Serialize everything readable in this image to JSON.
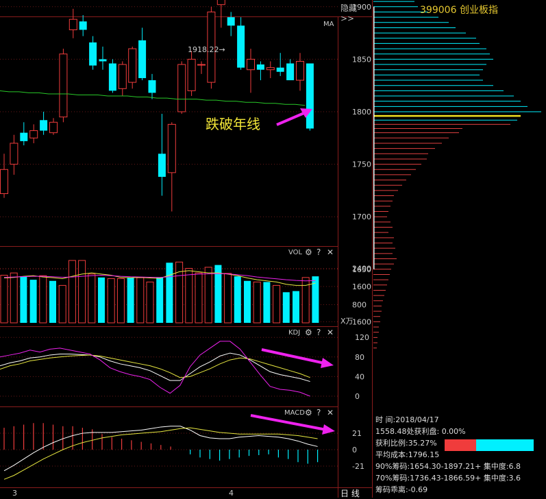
{
  "header": {
    "hide_label": "隐藏>>",
    "stock_title": "399006 创业板指"
  },
  "annotation": {
    "text": "跌破年线",
    "price_marker": "1918.22→"
  },
  "panes": {
    "main_label": "MA",
    "vol_label": "VOL",
    "kdj_label": "KDJ",
    "macd_label": "MACD",
    "vol_unit": "X万",
    "help": "?",
    "close": "✕",
    "settings": "⚙"
  },
  "x_axis": {
    "labels": [
      "3",
      "4"
    ]
  },
  "period_tabs": "日 线",
  "info": {
    "time": "时     间:2018/04/17",
    "profit_line": "1558.48处获利盘: 0.00%",
    "profit_ratio": "获利比例:35.27%",
    "avg_cost": "平均成本:1796.15",
    "chip90": "90%筹码:1654.30-1897.21+ 集中度:6.8",
    "chip70": "70%筹码:1736.43-1866.59+ 集中度:3.6",
    "chip_mult": "筹码乖离:-0.69"
  },
  "colors": {
    "up": "#f03c3c",
    "down": "#00f0ff",
    "ma": "#28c828",
    "title": "#e6c830",
    "arrow": "#ee22ee",
    "k": "#ffffff",
    "d": "#e8e840",
    "j": "#ee22ee"
  },
  "chart_data": {
    "type": "candlestick",
    "price_axis": {
      "ticks": [
        1900,
        1850,
        1800,
        1750,
        1700,
        1650,
        1600
      ]
    },
    "candles": [
      {
        "o": 1722,
        "h": 1760,
        "l": 1718,
        "c": 1745
      },
      {
        "o": 1750,
        "h": 1778,
        "l": 1740,
        "c": 1770
      },
      {
        "o": 1780,
        "h": 1790,
        "l": 1768,
        "c": 1772
      },
      {
        "o": 1775,
        "h": 1788,
        "l": 1770,
        "c": 1782
      },
      {
        "o": 1792,
        "h": 1800,
        "l": 1778,
        "c": 1782
      },
      {
        "o": 1780,
        "h": 1794,
        "l": 1778,
        "c": 1790
      },
      {
        "o": 1795,
        "h": 1860,
        "l": 1790,
        "c": 1855
      },
      {
        "o": 1878,
        "h": 1898,
        "l": 1870,
        "c": 1888
      },
      {
        "o": 1886,
        "h": 1892,
        "l": 1872,
        "c": 1878
      },
      {
        "o": 1866,
        "h": 1872,
        "l": 1840,
        "c": 1844
      },
      {
        "o": 1850,
        "h": 1862,
        "l": 1840,
        "c": 1848
      },
      {
        "o": 1846,
        "h": 1850,
        "l": 1818,
        "c": 1820
      },
      {
        "o": 1822,
        "h": 1848,
        "l": 1815,
        "c": 1845
      },
      {
        "o": 1828,
        "h": 1862,
        "l": 1822,
        "c": 1860
      },
      {
        "o": 1868,
        "h": 1880,
        "l": 1830,
        "c": 1832
      },
      {
        "o": 1830,
        "h": 1836,
        "l": 1812,
        "c": 1818
      },
      {
        "o": 1760,
        "h": 1798,
        "l": 1720,
        "c": 1738
      },
      {
        "o": 1742,
        "h": 1790,
        "l": 1705,
        "c": 1788
      },
      {
        "o": 1800,
        "h": 1848,
        "l": 1798,
        "c": 1845
      },
      {
        "o": 1820,
        "h": 1858,
        "l": 1815,
        "c": 1850
      },
      {
        "o": 1845,
        "h": 1848,
        "l": 1836,
        "c": 1845
      },
      {
        "o": 1828,
        "h": 1900,
        "l": 1822,
        "c": 1895
      },
      {
        "o": 1902,
        "h": 1920,
        "l": 1880,
        "c": 1912
      },
      {
        "o": 1890,
        "h": 1895,
        "l": 1872,
        "c": 1882
      },
      {
        "o": 1882,
        "h": 1890,
        "l": 1840,
        "c": 1842
      },
      {
        "o": 1840,
        "h": 1860,
        "l": 1818,
        "c": 1850
      },
      {
        "o": 1845,
        "h": 1848,
        "l": 1830,
        "c": 1840
      },
      {
        "o": 1840,
        "h": 1848,
        "l": 1832,
        "c": 1842
      },
      {
        "o": 1842,
        "h": 1856,
        "l": 1834,
        "c": 1838
      },
      {
        "o": 1846,
        "h": 1850,
        "l": 1830,
        "c": 1830
      },
      {
        "o": 1830,
        "h": 1856,
        "l": 1820,
        "c": 1848
      },
      {
        "o": 1846,
        "h": 1846,
        "l": 1782,
        "c": 1784
      }
    ],
    "ma_line": [
      1820,
      1819,
      1819,
      1818,
      1818,
      1817,
      1817,
      1817,
      1816,
      1816,
      1816,
      1815,
      1815,
      1815,
      1814,
      1814,
      1813,
      1813,
      1812,
      1812,
      1812,
      1811,
      1811,
      1810,
      1810,
      1809,
      1809,
      1808,
      1808,
      1807,
      1807,
      1806
    ],
    "volume": {
      "ticks": [
        2400,
        1600,
        800
      ],
      "bars": [
        2100,
        2200,
        2050,
        1900,
        2080,
        1850,
        1650,
        2750,
        2750,
        2150,
        2000,
        1950,
        1950,
        1980,
        1990,
        1800,
        2000,
        2650,
        2680,
        2400,
        2200,
        2450,
        2550,
        2180,
        2050,
        1850,
        1800,
        1800,
        1650,
        1350,
        1400,
        2000,
        2050
      ],
      "up": [
        true,
        true,
        false,
        false,
        true,
        false,
        true,
        true,
        true,
        true,
        false,
        true,
        true,
        false,
        true,
        true,
        false,
        false,
        true,
        true,
        true,
        true,
        false,
        true,
        false,
        false,
        true,
        false,
        true,
        false,
        false,
        true,
        false
      ],
      "ma1": [
        1980,
        2000,
        2050,
        2080,
        2020,
        1990,
        1950,
        2050,
        2150,
        2200,
        2150,
        2100,
        2000,
        1990,
        2000,
        1980,
        1960,
        2100,
        2250,
        2300,
        2250,
        2200,
        2200,
        2150,
        2080,
        1980,
        1900,
        1850,
        1800,
        1700,
        1650,
        1650,
        1750
      ],
      "ma2": [
        2000,
        2020,
        2040,
        2050,
        2050,
        2030,
        2010,
        2020,
        2050,
        2080,
        2100,
        2080,
        2050,
        2030,
        2020,
        2010,
        2000,
        2030,
        2080,
        2120,
        2150,
        2160,
        2170,
        2160,
        2120,
        2080,
        2020,
        1980,
        1940,
        1900,
        1870,
        1850,
        1860
      ]
    },
    "kdj": {
      "ticks": [
        120,
        80,
        40,
        0
      ],
      "k": [
        62,
        68,
        72,
        78,
        80,
        84,
        86,
        86,
        85,
        84,
        80,
        72,
        66,
        62,
        58,
        52,
        42,
        32,
        32,
        46,
        60,
        70,
        82,
        88,
        84,
        74,
        62,
        50,
        44,
        40,
        36,
        30
      ],
      "d": [
        55,
        62,
        66,
        72,
        75,
        78,
        80,
        82,
        83,
        84,
        82,
        78,
        74,
        70,
        66,
        62,
        56,
        48,
        38,
        40,
        48,
        56,
        66,
        74,
        78,
        76,
        70,
        64,
        58,
        52,
        46,
        38
      ],
      "j": [
        80,
        84,
        88,
        94,
        90,
        96,
        98,
        94,
        90,
        86,
        74,
        58,
        50,
        44,
        40,
        34,
        18,
        6,
        22,
        60,
        84,
        98,
        112,
        112,
        96,
        70,
        44,
        20,
        14,
        12,
        8,
        0
      ]
    },
    "macd": {
      "ticks": [
        21,
        0,
        -21
      ],
      "hist": [
        28,
        30,
        32,
        34,
        34,
        32,
        30,
        30,
        28,
        26,
        20,
        16,
        14,
        12,
        10,
        8,
        6,
        4,
        0,
        -6,
        -10,
        -12,
        -14,
        -12,
        -10,
        -8,
        -7,
        -6,
        -10,
        -12,
        -16,
        -18,
        -16
      ],
      "dif": [
        -27,
        -20,
        -12,
        -4,
        3,
        9,
        14,
        18,
        21,
        22,
        22,
        22,
        23,
        24,
        25,
        27,
        29,
        30,
        30,
        25,
        18,
        15,
        14,
        14,
        16,
        17,
        18,
        17,
        16,
        14,
        11,
        7,
        4
      ],
      "dea": [
        -38,
        -33,
        -26,
        -19,
        -12,
        -6,
        0,
        5,
        9,
        12,
        15,
        17,
        19,
        20,
        21,
        22,
        23,
        25,
        27,
        28,
        26,
        24,
        22,
        21,
        20,
        20,
        20,
        20,
        20,
        19,
        18,
        16,
        14
      ]
    },
    "chips": {
      "bands": [
        {
          "price": 1930,
          "len": 20,
          "color": "down"
        },
        {
          "price": 1925,
          "len": 35,
          "color": "down"
        },
        {
          "price": 1920,
          "len": 55,
          "color": "down"
        },
        {
          "price": 1915,
          "len": 42,
          "color": "down"
        },
        {
          "price": 1910,
          "len": 55,
          "color": "down"
        },
        {
          "price": 1905,
          "len": 60,
          "color": "down"
        },
        {
          "price": 1900,
          "len": 65,
          "color": "down"
        },
        {
          "price": 1895,
          "len": 80,
          "color": "down"
        },
        {
          "price": 1890,
          "len": 95,
          "color": "down"
        },
        {
          "price": 1885,
          "len": 110,
          "color": "down"
        },
        {
          "price": 1880,
          "len": 120,
          "color": "down"
        },
        {
          "price": 1875,
          "len": 135,
          "color": "down"
        },
        {
          "price": 1870,
          "len": 150,
          "color": "down"
        },
        {
          "price": 1865,
          "len": 155,
          "color": "down"
        },
        {
          "price": 1860,
          "len": 165,
          "color": "down"
        },
        {
          "price": 1855,
          "len": 170,
          "color": "down"
        },
        {
          "price": 1850,
          "len": 175,
          "color": "down"
        },
        {
          "price": 1845,
          "len": 165,
          "color": "down"
        },
        {
          "price": 1840,
          "len": 160,
          "color": "down"
        },
        {
          "price": 1835,
          "len": 155,
          "color": "down"
        },
        {
          "price": 1830,
          "len": 160,
          "color": "down"
        },
        {
          "price": 1825,
          "len": 175,
          "color": "down"
        },
        {
          "price": 1820,
          "len": 190,
          "color": "down"
        },
        {
          "price": 1815,
          "len": 205,
          "color": "down"
        },
        {
          "price": 1810,
          "len": 215,
          "color": "down"
        },
        {
          "price": 1805,
          "len": 225,
          "color": "down"
        },
        {
          "price": 1800,
          "len": 245,
          "color": "down"
        },
        {
          "price": 1796,
          "len": 215,
          "color": "avg"
        },
        {
          "price": 1792,
          "len": 210,
          "color": "down"
        },
        {
          "price": 1788,
          "len": 200,
          "color": "up"
        },
        {
          "price": 1784,
          "len": 130,
          "color": "up"
        },
        {
          "price": 1780,
          "len": 125,
          "color": "up"
        },
        {
          "price": 1775,
          "len": 110,
          "color": "up"
        },
        {
          "price": 1770,
          "len": 100,
          "color": "up"
        },
        {
          "price": 1765,
          "len": 90,
          "color": "up"
        },
        {
          "price": 1760,
          "len": 80,
          "color": "up"
        },
        {
          "price": 1755,
          "len": 78,
          "color": "up"
        },
        {
          "price": 1750,
          "len": 70,
          "color": "up"
        },
        {
          "price": 1745,
          "len": 62,
          "color": "up"
        },
        {
          "price": 1740,
          "len": 55,
          "color": "up"
        },
        {
          "price": 1735,
          "len": 48,
          "color": "up"
        },
        {
          "price": 1730,
          "len": 42,
          "color": "up"
        },
        {
          "price": 1725,
          "len": 36,
          "color": "up"
        },
        {
          "price": 1720,
          "len": 30,
          "color": "up"
        },
        {
          "price": 1715,
          "len": 28,
          "color": "up"
        },
        {
          "price": 1710,
          "len": 25,
          "color": "up"
        },
        {
          "price": 1705,
          "len": 22,
          "color": "up"
        },
        {
          "price": 1700,
          "len": 20,
          "color": "up"
        },
        {
          "price": 1695,
          "len": 25,
          "color": "up"
        },
        {
          "price": 1690,
          "len": 28,
          "color": "up"
        },
        {
          "price": 1685,
          "len": 22,
          "color": "up"
        },
        {
          "price": 1680,
          "len": 30,
          "color": "up"
        },
        {
          "price": 1675,
          "len": 28,
          "color": "up"
        },
        {
          "price": 1670,
          "len": 32,
          "color": "up"
        },
        {
          "price": 1665,
          "len": 28,
          "color": "up"
        },
        {
          "price": 1660,
          "len": 34,
          "color": "up"
        },
        {
          "price": 1655,
          "len": 30,
          "color": "up"
        },
        {
          "price": 1650,
          "len": 26,
          "color": "up"
        },
        {
          "price": 1645,
          "len": 24,
          "color": "up"
        },
        {
          "price": 1640,
          "len": 22,
          "color": "up"
        },
        {
          "price": 1635,
          "len": 20,
          "color": "up"
        },
        {
          "price": 1630,
          "len": 18,
          "color": "up"
        },
        {
          "price": 1625,
          "len": 16,
          "color": "up"
        },
        {
          "price": 1620,
          "len": 14,
          "color": "up"
        },
        {
          "price": 1615,
          "len": 12,
          "color": "up"
        },
        {
          "price": 1610,
          "len": 12,
          "color": "up"
        },
        {
          "price": 1605,
          "len": 10,
          "color": "up"
        },
        {
          "price": 1600,
          "len": 10,
          "color": "up"
        },
        {
          "price": 1595,
          "len": 8,
          "color": "up"
        },
        {
          "price": 1590,
          "len": 8,
          "color": "up"
        },
        {
          "price": 1585,
          "len": 6,
          "color": "up"
        },
        {
          "price": 1580,
          "len": 6,
          "color": "up"
        },
        {
          "price": 1575,
          "len": 5,
          "color": "up"
        }
      ],
      "range": [
        1650,
        1900
      ],
      "profit_ratio": 0.3527
    }
  }
}
